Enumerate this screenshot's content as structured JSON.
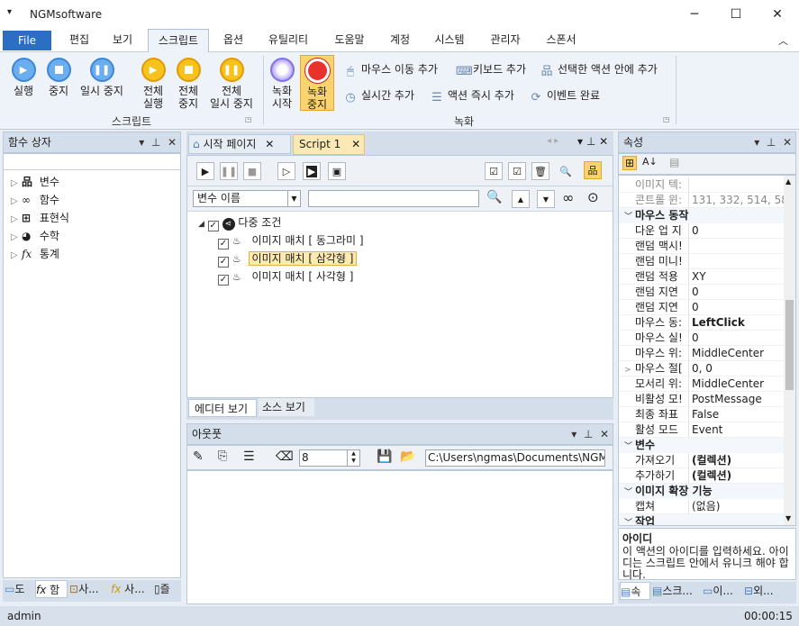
{
  "app": {
    "title": "NGMsoftware"
  },
  "menu": {
    "file": "File",
    "items": [
      "편집",
      "보기",
      "스크립트",
      "옵션",
      "유틸리티",
      "도움말",
      "계정",
      "시스템",
      "관리자",
      "스폰서"
    ]
  },
  "ribbon": {
    "script_group": {
      "label": "스크립트",
      "run": "실행",
      "stop": "중지",
      "pause": "일시 중지",
      "run_all_1": "전체",
      "run_all_2": "실행",
      "stop_all_1": "전체",
      "stop_all_2": "중지",
      "pause_all_1": "전체",
      "pause_all_2": "일시 중지"
    },
    "record_group": {
      "label": "녹화",
      "rec_start_1": "녹화",
      "rec_start_2": "시작",
      "rec_stop_1": "녹화",
      "rec_stop_2": "중지",
      "mouse_move": "마우스 이동 추가",
      "keyboard": "키보드 추가",
      "in_selected": "선택한 액션 안에 추가",
      "realtime": "실시간 추가",
      "action_now": "액션 즉시 추가",
      "event_done": "이벤트 완료"
    }
  },
  "func_box": {
    "title": "함수 상자",
    "items": [
      "변수",
      "함수",
      "표현식",
      "수학",
      "통계"
    ],
    "bottom_tabs": [
      "도",
      "함",
      "사...",
      "사...",
      "즐"
    ]
  },
  "editor": {
    "tabs": [
      "시작 페이지",
      "Script 1"
    ],
    "var_select": "변수 이름",
    "search_value": "",
    "root": "다중 조건",
    "children": [
      "이미지 매치 [ 동그라미 ]",
      "이미지 매치 [ 삼각형 ]",
      "이미지 매치 [ 사각형 ]"
    ],
    "view_tabs": [
      "에디터 보기",
      "소스 보기"
    ]
  },
  "output": {
    "title": "아웃풋",
    "number": "8",
    "path": "C:\\Users\\ngmas\\Documents\\NGM6\\"
  },
  "props": {
    "title": "속성",
    "rows": [
      {
        "k": "이미지 텍:",
        "v": "",
        "dim": true
      },
      {
        "k": "콘트롤 윈:",
        "v": "131, 332, 514, 581",
        "dim": true
      },
      {
        "cat": "마우스 동작"
      },
      {
        "k": "다운 업 지",
        "v": "0"
      },
      {
        "k": "랜덤 맥시!",
        "v": ""
      },
      {
        "k": "랜덤 미니!",
        "v": ""
      },
      {
        "k": "랜덤 적용",
        "v": "XY"
      },
      {
        "k": "랜덤 지연",
        "v": "0"
      },
      {
        "k": "랜덤 지연",
        "v": "0"
      },
      {
        "k": "마우스 동:",
        "v": "LeftClick",
        "bold": true
      },
      {
        "k": "마우스 실!",
        "v": "0"
      },
      {
        "k": "마우스 위:",
        "v": "MiddleCenter"
      },
      {
        "k": "마우스 절[",
        "v": "0, 0",
        "exp": true
      },
      {
        "k": "모서리 위:",
        "v": "MiddleCenter"
      },
      {
        "k": "비활성 모!",
        "v": "PostMessage"
      },
      {
        "k": "최종 좌표",
        "v": "False"
      },
      {
        "k": "활성 모드",
        "v": "Event"
      },
      {
        "cat": "변수"
      },
      {
        "k": "가져오기",
        "v": "(컬렉션)",
        "bold": true
      },
      {
        "k": "추가하기",
        "v": "(컬렉션)",
        "bold": true
      },
      {
        "cat": "이미지 확장 기능"
      },
      {
        "k": "캡쳐",
        "v": "(없음)"
      },
      {
        "cat": "작업"
      }
    ],
    "desc_title": "아이디",
    "desc_text": "이 액션의 아이디를 입력하세요. 아이디는 스크립트 안에서 유니크 해야 합니다.",
    "bottom_tabs": [
      "속",
      "스크...",
      "이...",
      "외..."
    ]
  },
  "status": {
    "user": "admin",
    "time": "00:00:15"
  }
}
